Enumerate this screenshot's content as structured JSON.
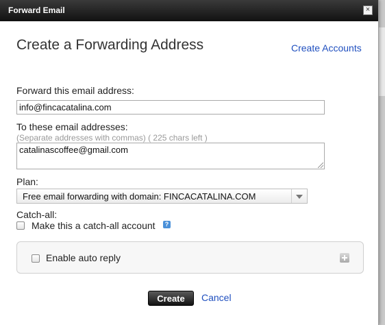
{
  "window": {
    "title": "Forward Email",
    "close_glyph": "×"
  },
  "page": {
    "heading": "Create a Forwarding Address",
    "create_accounts_link": "Create Accounts"
  },
  "form": {
    "forward_label": "Forward this email address:",
    "forward_value": "info@fincacatalina.com",
    "to_label": "To these email addresses:",
    "to_hint": "(Separate addresses with commas) ( 225 chars left )",
    "to_value": "catalinascoffee@gmail.com",
    "plan_label": "Plan:",
    "plan_value": "Free email forwarding with domain: FINCACATALINA.COM",
    "catchall_label": "Catch-all:",
    "catchall_checkbox_label": "Make this a catch-all account",
    "help_glyph": "?",
    "auto_reply_label": "Enable auto reply"
  },
  "buttons": {
    "create": "Create",
    "cancel": "Cancel"
  },
  "colors": {
    "link": "#1f4fbf",
    "titlebar": "#111111",
    "help": "#4a90d9"
  }
}
